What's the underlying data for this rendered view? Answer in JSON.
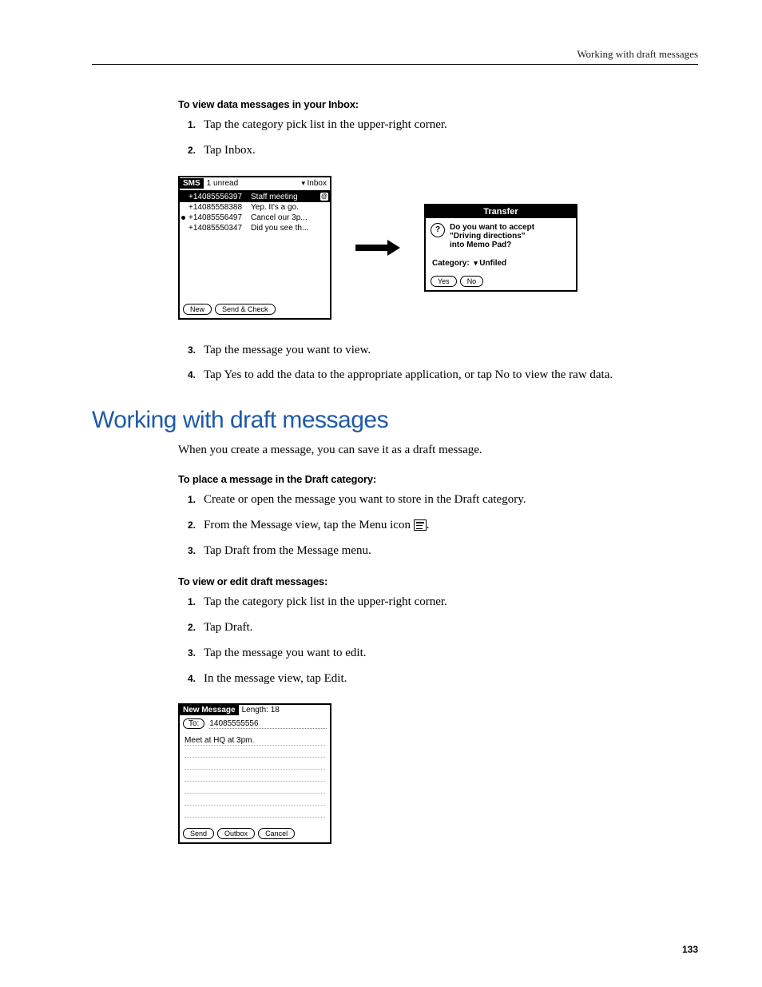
{
  "runningHead": "Working with draft messages",
  "sec1": {
    "heading": "To view data messages in your Inbox:",
    "steps": [
      "Tap the category pick list in the upper-right corner.",
      "Tap Inbox.",
      "Tap the message you want to view.",
      "Tap Yes to add the data to the appropriate application, or tap No to view the raw data."
    ]
  },
  "fig1": {
    "appName": "SMS",
    "status": "1 unread",
    "picker": "Inbox",
    "rows": [
      {
        "num": "+14085556397",
        "txt": "Staff meeting",
        "sel": true,
        "attach": true
      },
      {
        "num": "+14085558388",
        "txt": "Yep. It's a go."
      },
      {
        "num": "+14085556497",
        "txt": "Cancel our 3p...",
        "dot": true
      },
      {
        "num": "+14085550347",
        "txt": "Did you see th..."
      }
    ],
    "btnNew": "New",
    "btnSend": "Send & Check"
  },
  "fig2": {
    "title": "Transfer",
    "line1": "Do you want to accept",
    "line2": "\"Driving directions\"",
    "line3": "into Memo Pad?",
    "catLabel": "Category:",
    "catValue": "Unfiled",
    "btnYes": "Yes",
    "btnNo": "No"
  },
  "h2": "Working with draft messages",
  "intro": "When you create a message, you can save it as a draft message.",
  "sec2": {
    "heading": "To place a message in the Draft category:",
    "steps": [
      "Create or open the message you want to store in the Draft category.",
      "From the Message view, tap the Menu icon ",
      "Tap Draft from the Message menu."
    ]
  },
  "sec3": {
    "heading": "To view or edit draft messages:",
    "steps": [
      "Tap the category pick list in the upper-right corner.",
      "Tap Draft.",
      "Tap the message you want to edit.",
      "In the message view, tap Edit."
    ]
  },
  "fig3": {
    "title": "New Message",
    "length": "Length: 18",
    "toLabel": "To:",
    "toNum": "14085555556",
    "bodyLine": "Meet at HQ at 3pm.",
    "btnSend": "Send",
    "btnOutbox": "Outbox",
    "btnCancel": "Cancel"
  },
  "pageNumber": "133"
}
